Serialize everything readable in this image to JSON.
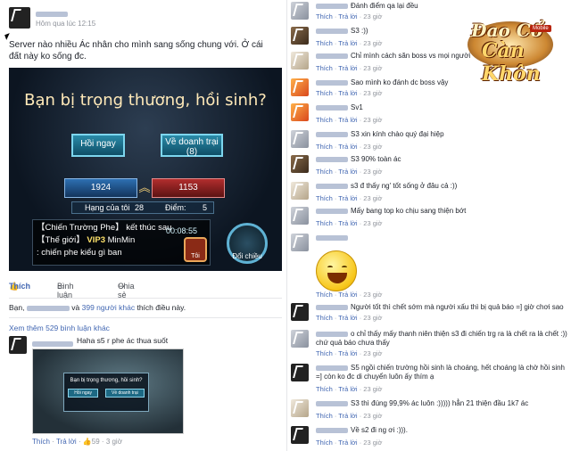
{
  "post": {
    "time": "Hôm qua lúc 12:15",
    "text": "Server nào nhiều Ác nhân cho mình sang sống chung với. Ở cái đất này ko sống đc."
  },
  "game": {
    "title": "Bạn bị trọng thương, hồi sinh?",
    "revive_btn": "Hồi ngay",
    "camp_btn": "Về doanh trại (8)",
    "score_left": "1924",
    "score_right": "1153",
    "rank_label": "Hạng của tôi",
    "rank_value": "28",
    "points_label": "Điểm:",
    "points_value": "5",
    "chat_line1": "【Chiến Trường Phe】 kết thúc sau",
    "chat_line2_prefix": "【Thế giới】",
    "chat_vip": "VIP3",
    "chat_line2_name": "MinMin",
    "chat_line3": ": chiến phe kiểu gì ban",
    "timer": "00:08:55",
    "swap_btn": "Đổi chiều",
    "fist_label": "Tôi"
  },
  "actions": {
    "like": "Thích",
    "comment": "Bình luận",
    "share": "Chia sẻ"
  },
  "likes_line": {
    "prefix": "Bạn,",
    "and": "và",
    "others": "399 người khác",
    "suffix": "thích điều này."
  },
  "more_comments": "Xem thêm 529 bình luận khác",
  "left_comment": {
    "text": "Haha s5 r phe ác thua suốt",
    "like": "Thích",
    "reply": "Trả lời",
    "count": "59",
    "time": "3 giờ",
    "mini_title": "Bạn bị trọng thương, hồi sinh?",
    "mini_btn1": "Hồi ngay",
    "mini_btn2": "Về doanh trại"
  },
  "right_comments": [
    {
      "text": "Đánh điểm qa lại đều",
      "like": "Thích",
      "reply": "Trả lời",
      "time": "23 giờ"
    },
    {
      "text": "S3 :))",
      "like": "Thích",
      "reply": "Trả lời",
      "time": "23 giờ"
    },
    {
      "text": "Chỉ mình cách săn boss vs mọi người",
      "like": "Thích",
      "reply": "Trả lời",
      "time": "23 giờ"
    },
    {
      "text": "Sao mình ko đánh dc boss vậy",
      "like": "Thích",
      "reply": "Trả lời",
      "time": "23 giờ"
    },
    {
      "text": "Sv1",
      "like": "Thích",
      "reply": "Trả lời",
      "time": "23 giờ"
    },
    {
      "text": "S3 xin kính chào quý đại hiệp",
      "like": "Thích",
      "reply": "Trả lời",
      "time": "23 giờ"
    },
    {
      "text": "S3 90% toàn ác",
      "like": "Thích",
      "reply": "Trả lời",
      "time": "23 giờ"
    },
    {
      "text": "s3 đ thấy ng' tốt sống ở đâu cả :))",
      "like": "Thích",
      "reply": "Trả lời",
      "time": "23 giờ"
    },
    {
      "text": "Mấy bang top ko chịu sang thiện bớt",
      "like": "Thích",
      "reply": "Trả lời",
      "time": "23 giờ"
    },
    {
      "text": "",
      "like": "Thích",
      "reply": "Trả lời",
      "time": "23 giờ"
    },
    {
      "text": "Người tốt thì chết sớm mà người xấu thì bị quả báo =] giờ chơi sao",
      "like": "Thích",
      "reply": "Trả lời",
      "time": "23 giờ"
    },
    {
      "text": "o chỉ thấy mấy thanh niên thiện s3 đi chiến trg ra là chết ra là chết :)) chứ quả báo chưa thấy",
      "like": "Thích",
      "reply": "Trả lời",
      "time": "23 giờ"
    },
    {
      "text": "S5 ngồi chiến trường hồi sinh là choáng, hết choáng là chờ hồi sinh =] còn ko đc di chuyển luôn ấy thím ạ",
      "like": "Thích",
      "reply": "Trả lời",
      "time": "23 giờ"
    },
    {
      "text": "S3 thì đúng 99,9% ác luôn :))))) hẳn 21 thiện đầu 1k7 ác",
      "like": "Thích",
      "reply": "Trả lời",
      "time": "23 giờ"
    },
    {
      "text": "Về s2 đi ng ơi :))).",
      "like": "Thích",
      "reply": "Trả lời",
      "time": "23 giờ"
    }
  ],
  "logo": {
    "line1": "Đao Cổ",
    "line2": "Càn Khôn",
    "tag": "Mobile"
  },
  "colors": {
    "link": "#4267b2",
    "meta": "#90949c",
    "name": "#365899"
  }
}
